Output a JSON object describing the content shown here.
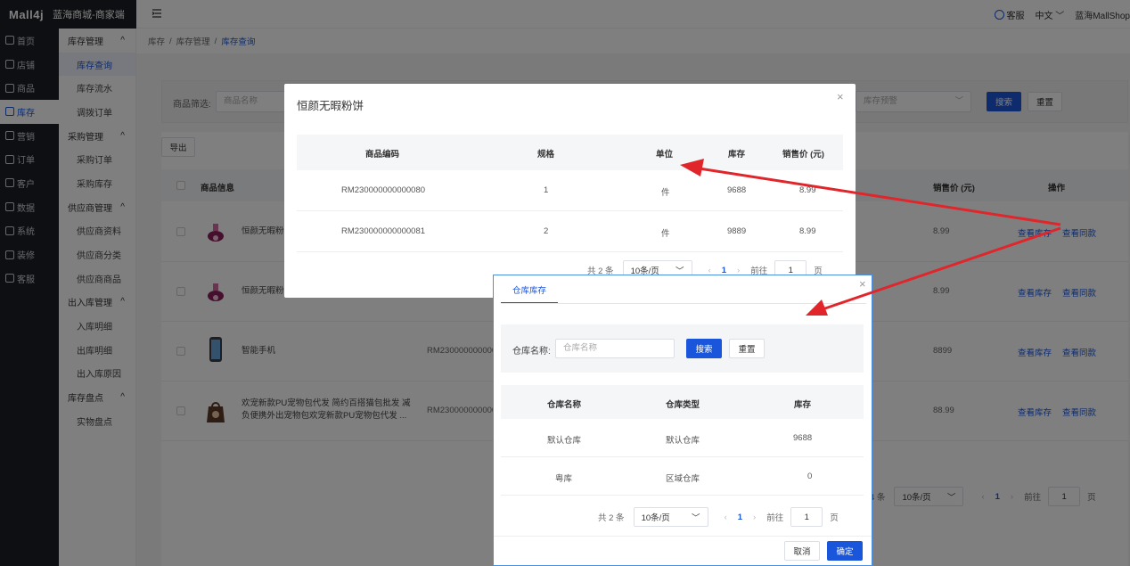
{
  "app": {
    "logo": "Mall4j",
    "title": "蓝海商城-商家端"
  },
  "header": {
    "service": "客服",
    "language": "中文",
    "user": "蓝海MallShop"
  },
  "sidebar_primary": [
    {
      "label": "首页",
      "icon": "home-icon"
    },
    {
      "label": "店铺",
      "icon": "shop-icon"
    },
    {
      "label": "商品",
      "icon": "goods-icon"
    },
    {
      "label": "库存",
      "icon": "stock-icon",
      "active": true
    },
    {
      "label": "营销",
      "icon": "gift-icon"
    },
    {
      "label": "订单",
      "icon": "order-icon"
    },
    {
      "label": "客户",
      "icon": "user-icon"
    },
    {
      "label": "数据",
      "icon": "data-icon"
    },
    {
      "label": "系统",
      "icon": "settings-icon"
    },
    {
      "label": "装修",
      "icon": "decorate-icon"
    },
    {
      "label": "客服",
      "icon": "chat-icon"
    }
  ],
  "sidebar_secondary": {
    "g1": "库存管理",
    "g1_items": [
      "库存查询",
      "库存流水",
      "调拨订单"
    ],
    "g2": "采购管理",
    "g2_items": [
      "采购订单",
      "采购库存"
    ],
    "g3": "供应商管理",
    "g3_items": [
      "供应商资料",
      "供应商分类",
      "供应商商品"
    ],
    "g4": "出入库管理",
    "g4_items": [
      "入库明细",
      "出库明细",
      "出入库原因"
    ],
    "g5": "库存盘点",
    "g5_items": [
      "实物盘点"
    ]
  },
  "breadcrumb": [
    "库存",
    "库存管理",
    "库存查询"
  ],
  "filter": {
    "label": "商品筛选:",
    "name_placeholder": "商品名称",
    "warning_placeholder": "库存预警",
    "search": "搜索",
    "reset": "重置"
  },
  "toolbar": {
    "export": "导出"
  },
  "table": {
    "headers": {
      "info": "商品信息",
      "price": "销售价 (元)",
      "op": "操作"
    },
    "rows": [
      {
        "name": "恒颜无暇粉",
        "code": "",
        "price": "8.99"
      },
      {
        "name": "恒颜无暇粉",
        "code": "",
        "price": "8.99"
      },
      {
        "name": "智能手机",
        "code": "RM230000000000",
        "price": "8899"
      },
      {
        "name": "欢宠新款PU宠物包代发 简约百搭猫包批发 减负便携外出宠物包欢宠新款PU宠物包代发 ...",
        "code": "RM230000000000",
        "price": "88.99"
      }
    ],
    "op_view_stock": "查看库存",
    "op_view_same": "查看同款"
  },
  "main_pager": {
    "total": "4 条",
    "size": "10条/页",
    "page": "1",
    "goto": "前往",
    "goto_value": "1",
    "unit": "页"
  },
  "dialog_sku": {
    "title": "恒颜无暇粉饼",
    "headers": [
      "商品编码",
      "规格",
      "单位",
      "库存",
      "销售价 (元)"
    ],
    "rows": [
      [
        "RM230000000000080",
        "1",
        "件",
        "9688",
        "8.99"
      ],
      [
        "RM230000000000081",
        "2",
        "件",
        "9889",
        "8.99"
      ]
    ],
    "pager": {
      "total": "共 2 条",
      "size": "10条/页",
      "page": "1",
      "goto": "前往",
      "goto_value": "1",
      "unit": "页"
    }
  },
  "dialog_warehouse": {
    "tab": "仓库库存",
    "filter_label": "仓库名称:",
    "filter_placeholder": "仓库名称",
    "search": "搜索",
    "reset": "重置",
    "headers": [
      "仓库名称",
      "仓库类型",
      "库存"
    ],
    "rows": [
      [
        "默认仓库",
        "默认仓库",
        "9688"
      ],
      [
        "粤库",
        "区域仓库",
        "0"
      ]
    ],
    "pager": {
      "total": "共 2 条",
      "size": "10条/页",
      "page": "1",
      "goto": "前往",
      "goto_value": "1",
      "unit": "页"
    },
    "cancel": "取消",
    "confirm": "确定"
  },
  "colors": {
    "accent": "#1a56db",
    "sidebar": "#1b1e24",
    "arrow": "#e0262b"
  }
}
